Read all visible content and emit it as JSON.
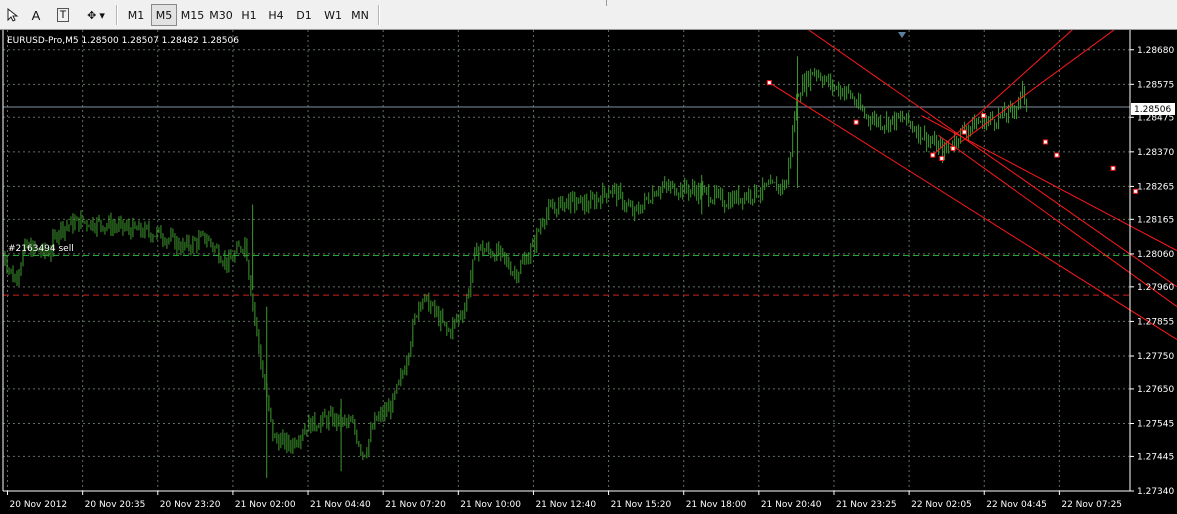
{
  "toolbar": {
    "tools": [
      {
        "name": "arrow-tool",
        "glyph": ""
      },
      {
        "name": "text-tool",
        "glyph": "A"
      },
      {
        "name": "text-label-tool",
        "glyph": "T"
      },
      {
        "name": "shapes-tool",
        "glyph": "✥ ▾"
      }
    ],
    "timeframes": [
      "M1",
      "M5",
      "M15",
      "M30",
      "H1",
      "H4",
      "D1",
      "W1",
      "MN"
    ],
    "active_timeframe": "M5"
  },
  "chart_header": "EURUSD-Pro,M5  1.28500 1.28507 1.28482 1.28506",
  "order_label": "#2163494 sell",
  "current_price": "1.28506",
  "colors": {
    "background": "#000000",
    "grid": "#5f6f5f",
    "candles": "#3e9a2e",
    "channel": "#ff1a1a",
    "order_line": "#22aa33",
    "stop_line": "#cc2222",
    "price_line": "#7f8fa0"
  },
  "chart_data": {
    "type": "candlestick",
    "symbol": "EURUSD-Pro",
    "timeframe": "M5",
    "ohlc": {
      "open": "1.28500",
      "high": "1.28507",
      "low": "1.28482",
      "close": "1.28506"
    },
    "ylim": [
      1.2734,
      1.2874
    ],
    "y_ticks": [
      "1.28680",
      "1.28575",
      "1.28475",
      "1.28370",
      "1.28265",
      "1.28165",
      "1.28060",
      "1.27960",
      "1.27855",
      "1.27750",
      "1.27650",
      "1.27545",
      "1.27445",
      "1.27340"
    ],
    "x_labels": [
      "20 Nov 2012",
      "20 Nov 20:35",
      "20 Nov 23:20",
      "21 Nov 02:00",
      "21 Nov 04:40",
      "21 Nov 07:20",
      "21 Nov 10:00",
      "21 Nov 12:40",
      "21 Nov 15:20",
      "21 Nov 18:00",
      "21 Nov 20:40",
      "21 Nov 23:25",
      "22 Nov 02:05",
      "22 Nov 04:45",
      "22 Nov 07:25"
    ],
    "price_path": [
      [
        0,
        1.2806
      ],
      [
        0.01,
        1.2798
      ],
      [
        0.02,
        1.2808
      ],
      [
        0.04,
        1.2806
      ],
      [
        0.05,
        1.2814
      ],
      [
        0.07,
        1.2816
      ],
      [
        0.09,
        1.2815
      ],
      [
        0.12,
        1.2813
      ],
      [
        0.14,
        1.2812
      ],
      [
        0.16,
        1.2808
      ],
      [
        0.18,
        1.2811
      ],
      [
        0.2,
        1.2803
      ],
      [
        0.215,
        1.281
      ],
      [
        0.22,
        1.2795
      ],
      [
        0.23,
        1.277
      ],
      [
        0.24,
        1.275
      ],
      [
        0.255,
        1.2748
      ],
      [
        0.27,
        1.2754
      ],
      [
        0.29,
        1.2756
      ],
      [
        0.31,
        1.2754
      ],
      [
        0.32,
        1.2745
      ],
      [
        0.33,
        1.2755
      ],
      [
        0.345,
        1.276
      ],
      [
        0.355,
        1.277
      ],
      [
        0.37,
        1.2793
      ],
      [
        0.38,
        1.279
      ],
      [
        0.395,
        1.2782
      ],
      [
        0.41,
        1.279
      ],
      [
        0.42,
        1.2808
      ],
      [
        0.44,
        1.2806
      ],
      [
        0.455,
        1.28
      ],
      [
        0.47,
        1.2808
      ],
      [
        0.48,
        1.2818
      ],
      [
        0.5,
        1.2822
      ],
      [
        0.52,
        1.2821
      ],
      [
        0.54,
        1.2826
      ],
      [
        0.56,
        1.2818
      ],
      [
        0.58,
        1.2826
      ],
      [
        0.6,
        1.2826
      ],
      [
        0.62,
        1.2825
      ],
      [
        0.64,
        1.2822
      ],
      [
        0.66,
        1.2824
      ],
      [
        0.68,
        1.2826
      ],
      [
        0.695,
        1.2827
      ],
      [
        0.705,
        1.2855
      ],
      [
        0.72,
        1.2862
      ],
      [
        0.735,
        1.2857
      ],
      [
        0.75,
        1.2855
      ],
      [
        0.765,
        1.2848
      ],
      [
        0.78,
        1.2846
      ],
      [
        0.8,
        1.2847
      ],
      [
        0.82,
        1.2841
      ],
      [
        0.835,
        1.2837
      ],
      [
        0.85,
        1.2843
      ],
      [
        0.865,
        1.2846
      ],
      [
        0.88,
        1.2847
      ],
      [
        0.895,
        1.2849
      ],
      [
        0.905,
        1.2855
      ],
      [
        0.91,
        1.2849
      ]
    ],
    "order_line_price": 1.28055,
    "stop_line_price": 1.27935,
    "current_price_value": 1.28506,
    "channel_lines": [
      [
        [
          1.2874,
          0.715
        ],
        [
          1.2796,
          1.0
        ]
      ],
      [
        [
          1.2858,
          0.68
        ],
        [
          1.278,
          1.0
        ]
      ],
      [
        [
          1.2848,
          0.815
        ],
        [
          1.2807,
          1.0
        ]
      ],
      [
        [
          1.2842,
          0.83
        ],
        [
          1.279,
          1.0
        ]
      ],
      [
        [
          1.2836,
          0.825
        ],
        [
          1.2878,
          0.92
        ]
      ],
      [
        [
          1.284,
          0.85
        ],
        [
          1.2878,
          0.96
        ]
      ]
    ],
    "channel_points": [
      [
        0.68,
        1.2858
      ],
      [
        0.757,
        1.2846
      ],
      [
        0.825,
        1.2836
      ],
      [
        0.833,
        1.2835
      ],
      [
        0.843,
        1.2838
      ],
      [
        0.853,
        1.2843
      ],
      [
        0.87,
        1.2848
      ],
      [
        0.925,
        1.284
      ],
      [
        0.935,
        1.2836
      ],
      [
        0.985,
        1.2832
      ],
      [
        1.005,
        1.2825
      ]
    ]
  }
}
